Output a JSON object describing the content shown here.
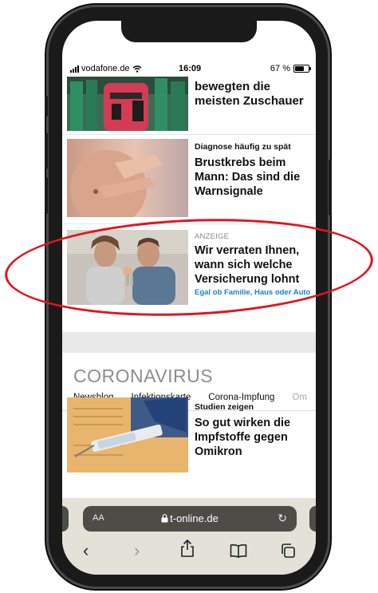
{
  "status": {
    "carrier": "vodafone.de",
    "time": "16:09",
    "battery_text": "67 %",
    "battery_level": 0.67
  },
  "articles": [
    {
      "kicker": "",
      "headline": "bewegten die meisten Zuschauer",
      "image": "Person in red jumpsuit among figures in green tracksuits"
    },
    {
      "kicker": "Diagnose häufig zu spät",
      "headline": "Brustkrebs beim Mann: Das sind die Warnsignale",
      "image": "Shirtless man holding his chest"
    },
    {
      "kicker": "ANZEIGE",
      "headline": "Wir verraten Ihnen, wann sich welche Versicherung lohnt",
      "sub": "Egal ob Familie, Haus oder Auto",
      "image": "Couple holding up house keys"
    }
  ],
  "section": {
    "title": "CORONAVIRUS",
    "tabs": [
      "Newsblog",
      "Infektionskarte",
      "Corona-Impfung",
      "Om"
    ]
  },
  "covid_article": {
    "kicker": "Studien zeigen",
    "headline": "So gut wirken die Impfstoffe gegen Omikron",
    "image": "Vaccination certificate with syringe"
  },
  "browser": {
    "text_size_label": "AA",
    "url": "t-online.de",
    "toolbar_icons": [
      "back-icon",
      "forward-icon",
      "share-icon",
      "bookmarks-icon",
      "tabs-icon"
    ]
  },
  "colors": {
    "annotation_red": "#e2141e",
    "link_blue": "#1a82c4",
    "section_grey": "#8e8e8e"
  }
}
